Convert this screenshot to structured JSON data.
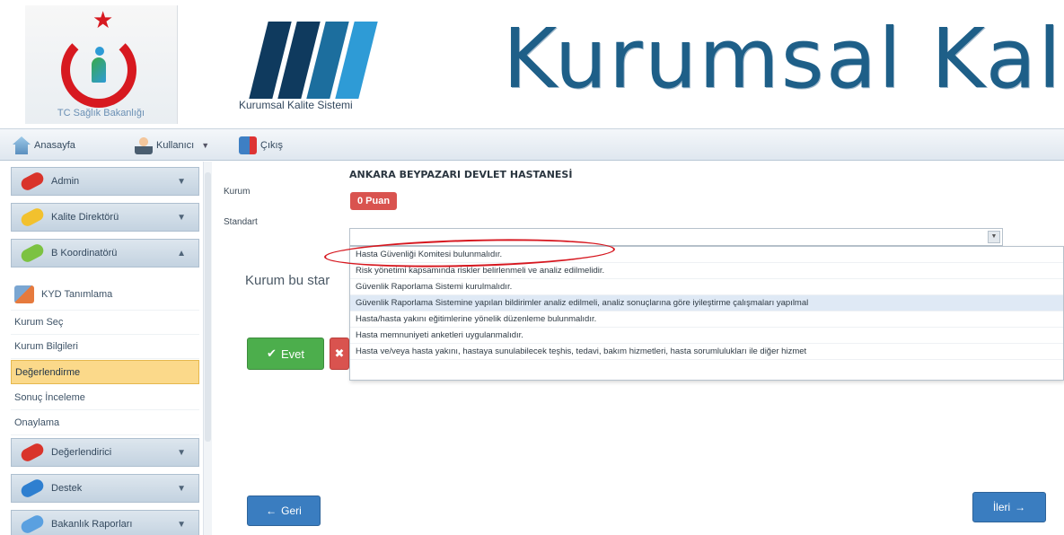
{
  "header": {
    "ministry_caption": "TC Sağlık Bakanlığı",
    "kks_caption": "Kurumsal Kalite Sistemi",
    "brand_title": "Kurumsal Kal"
  },
  "toolbar": {
    "home": "Anasayfa",
    "user": "Kullanıcı",
    "logout": "Çıkış"
  },
  "sidebar": {
    "accordion": {
      "admin": "Admin",
      "kalite_direktoru": "Kalite Direktörü",
      "b_koordinatoru": "B Koordinatörü",
      "degerlendirici": "Değerlendirici",
      "destek": "Destek",
      "bakanlik_raporlari": "Bakanlık Raporları"
    },
    "items": [
      "KYD Tanımlama",
      "Kurum Seç",
      "Kurum Bilgileri",
      "Değerlendirme",
      "Sonuç İnceleme",
      "Onaylama"
    ]
  },
  "main": {
    "kurum_label": "Kurum",
    "standart_label": "Standart",
    "hospital_name": "ANKARA BEYPAZARI DEVLET HASTANESİ",
    "score": "0 Puan",
    "confirm_text": "Kurum bu star",
    "evet": "Evet",
    "geri": "Geri",
    "ileri": "İleri"
  },
  "dropdown_options": [
    "Hasta Güvenliği Komitesi bulunmalıdır.",
    "Risk yönetimi kapsamında riskler belirlenmeli ve analiz edilmelidir.",
    "Güvenlik Raporlama Sistemi kurulmalıdır.",
    "Güvenlik Raporlama Sistemine yapılan bildirimler analiz edilmeli, analiz sonuçlarına göre iyileştirme çalışmaları yapılmal",
    "Hasta/hasta yakını eğitimlerine yönelik düzenleme bulunmalıdır.",
    "Hasta memnuniyeti anketleri uygulanmalıdır.",
    "Hasta ve/veya hasta yakını, hastaya sunulabilecek teşhis, tedavi, bakım hizmetleri, hasta sorumlulukları ile diğer hizmet"
  ],
  "colors": {
    "brand_blue": "#1e5f88",
    "active_item": "#fbd98a",
    "danger": "#d9534f",
    "success": "#4cae4c",
    "primary": "#3a7dc0",
    "annotation_red": "#d6171f"
  }
}
